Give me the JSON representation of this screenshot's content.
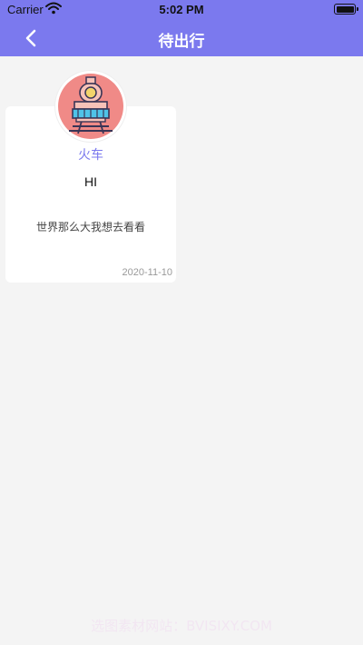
{
  "status": {
    "carrier": "Carrier",
    "time": "5:02 PM"
  },
  "nav": {
    "title": "待出行"
  },
  "card": {
    "type": "火车",
    "title": "HI",
    "description": "世界那么大我想去看看",
    "date": "2020-11-10",
    "icon": "train-icon"
  },
  "watermark": "选图素材网站：BVISIXY.COM",
  "colors": {
    "accent": "#7b79ee",
    "background": "#f4f4f4",
    "avatar_circle": "#f08a87"
  }
}
